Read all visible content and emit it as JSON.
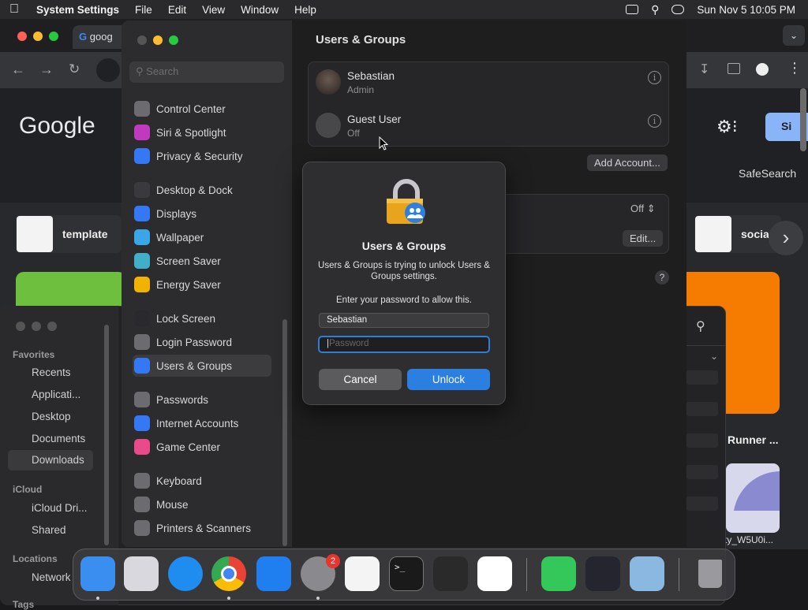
{
  "menubar": {
    "app_name": "System Settings",
    "items": [
      "File",
      "Edit",
      "View",
      "Window",
      "Help"
    ],
    "datetime": "Sun Nov 5  10:05 PM"
  },
  "chrome": {
    "tab_label": "goog",
    "logo_text": "Google",
    "sign_in": "Si",
    "safesearch": "SafeSearch",
    "thumbs": [
      {
        "label": "template"
      },
      {
        "label": "socia"
      }
    ],
    "card_title": "Runner ...",
    "card_file": "ty_W5U0i..."
  },
  "finder": {
    "favorites_header": "Favorites",
    "favorites": [
      "Recents",
      "Applicati...",
      "Desktop",
      "Documents",
      "Downloads"
    ],
    "icloud_header": "iCloud",
    "icloud": [
      "iCloud Dri...",
      "Shared"
    ],
    "locations_header": "Locations",
    "locations": [
      "Network"
    ],
    "tags_header": "Tags"
  },
  "settings": {
    "search_placeholder": "Search",
    "nav_groups": [
      [
        {
          "label": "Control Center",
          "icon": "control-center-icon",
          "color": "#6b6b70"
        },
        {
          "label": "Siri & Spotlight",
          "icon": "siri-icon",
          "color": "#c03ac0"
        },
        {
          "label": "Privacy & Security",
          "icon": "hand-icon",
          "color": "#3478f6"
        }
      ],
      [
        {
          "label": "Desktop & Dock",
          "icon": "dock-icon",
          "color": "#3a3a3e"
        },
        {
          "label": "Displays",
          "icon": "displays-icon",
          "color": "#3478f6"
        },
        {
          "label": "Wallpaper",
          "icon": "wallpaper-icon",
          "color": "#3aa6e8"
        },
        {
          "label": "Screen Saver",
          "icon": "screen-saver-icon",
          "color": "#40b0c8"
        },
        {
          "label": "Energy Saver",
          "icon": "energy-saver-icon",
          "color": "#f0b400"
        }
      ],
      [
        {
          "label": "Lock Screen",
          "icon": "lock-icon",
          "color": "#2a2a2e"
        },
        {
          "label": "Login Password",
          "icon": "login-password-icon",
          "color": "#6b6b70"
        },
        {
          "label": "Users & Groups",
          "icon": "users-icon",
          "color": "#3478f6"
        }
      ],
      [
        {
          "label": "Passwords",
          "icon": "key-icon",
          "color": "#6b6b70"
        },
        {
          "label": "Internet Accounts",
          "icon": "at-icon",
          "color": "#3478f6"
        },
        {
          "label": "Game Center",
          "icon": "game-center-icon",
          "color": "#e84a8a"
        }
      ],
      [
        {
          "label": "Keyboard",
          "icon": "keyboard-icon",
          "color": "#6b6b70"
        },
        {
          "label": "Mouse",
          "icon": "mouse-icon",
          "color": "#6b6b70"
        },
        {
          "label": "Printers & Scanners",
          "icon": "printer-icon",
          "color": "#6b6b70"
        }
      ]
    ],
    "selected": "Users & Groups",
    "page_title": "Users & Groups",
    "users": [
      {
        "name": "Sebastian",
        "role": "Admin"
      },
      {
        "name": "Guest User",
        "role": "Off"
      }
    ],
    "add_account": "Add Account...",
    "setting_value": "Off",
    "edit_label": "Edit...",
    "help_label": "?"
  },
  "dialog": {
    "title": "Users & Groups",
    "message": "Users & Groups is trying to unlock Users & Groups settings.",
    "prompt": "Enter your password to allow this.",
    "username": "Sebastian",
    "password_placeholder": "Password",
    "cancel": "Cancel",
    "unlock": "Unlock"
  },
  "dock": {
    "apps": [
      {
        "name": "finder-icon",
        "color": "#3a8ef0"
      },
      {
        "name": "launchpad-icon",
        "color": "#d8d8de"
      },
      {
        "name": "safari-icon",
        "color": "#1f8cf0"
      },
      {
        "name": "chrome-icon",
        "color": "#ffffff"
      },
      {
        "name": "app-store-icon",
        "color": "#1f7ff0"
      },
      {
        "name": "system-settings-icon",
        "color": "#8a8a8e"
      },
      {
        "name": "textedit-icon",
        "color": "#f4f4f4"
      },
      {
        "name": "terminal-icon",
        "color": "#1a1a1a"
      },
      {
        "name": "garageband-icon",
        "color": "#2a2a2a"
      },
      {
        "name": "vscode-icon",
        "color": "#ffffff"
      },
      {
        "name": "messages-icon",
        "color": "#34c759"
      },
      {
        "name": "obs-icon",
        "color": "#252530"
      },
      {
        "name": "preview-icon",
        "color": "#8ab8e0"
      },
      {
        "name": "trash-icon",
        "color": "#9a9a9e"
      }
    ],
    "badge_count": "2"
  }
}
